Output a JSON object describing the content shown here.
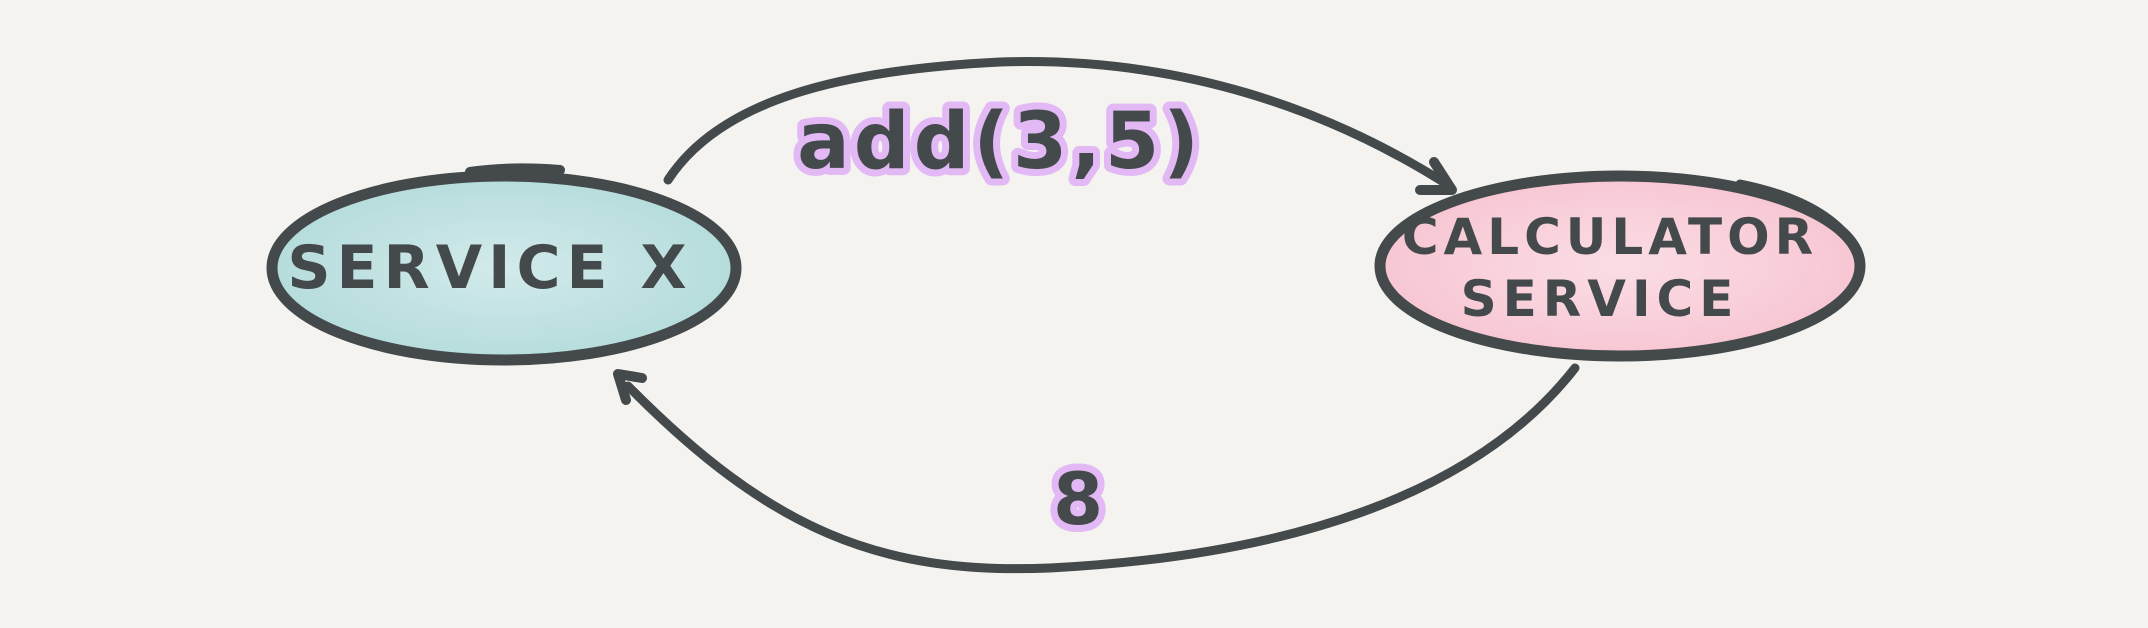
{
  "diagram": {
    "background": "#f4f3f0",
    "ink_color": "#44494b",
    "highlight_color": "#e2b9f5",
    "nodes": [
      {
        "id": "service-x",
        "label_lines": [
          "SERVICE X"
        ],
        "fill": "#c4e2e2"
      },
      {
        "id": "calculator-service",
        "label_lines": [
          "CALCULATOR",
          "SERVICE"
        ],
        "fill": "#f9d3dd"
      }
    ],
    "edges": [
      {
        "from": "service-x",
        "to": "calculator-service",
        "label": "add(3,5)"
      },
      {
        "from": "calculator-service",
        "to": "service-x",
        "label": "8"
      }
    ]
  }
}
